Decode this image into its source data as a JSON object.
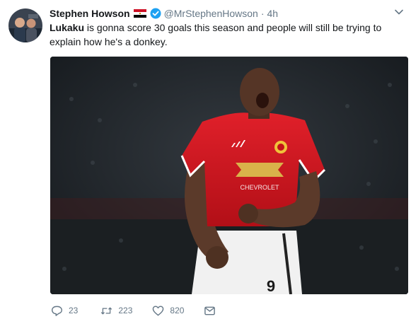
{
  "tweet": {
    "author_name": "Stephen Howson",
    "handle": "@MrStephenHowson",
    "separator": "·",
    "time": "4h",
    "text_bold": "Lukaku",
    "text_rest": " is gonna score 30 goals this season and people will still be trying to explain how he's a donkey."
  },
  "actions": {
    "replies": "23",
    "retweets": "223",
    "likes": "820"
  },
  "media": {
    "description_icon": "photo",
    "jersey_sponsor": "CHEVROLET",
    "shirt_number": "9"
  },
  "colors": {
    "text": "#14171a",
    "muted": "#657786",
    "verified": "#1da1f2",
    "jersey_red": "#d3141c"
  }
}
